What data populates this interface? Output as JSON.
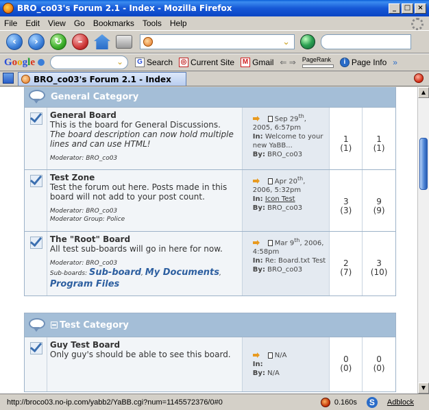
{
  "window": {
    "title": "BRO_co03's Forum 2.1 - Index - Mozilla Firefox",
    "controls": [
      "_",
      "□",
      "×"
    ]
  },
  "menu": [
    "File",
    "Edit",
    "View",
    "Go",
    "Bookmarks",
    "Tools",
    "Help"
  ],
  "nav": {
    "url_value": ""
  },
  "google_toolbar": {
    "search_label": "Search",
    "current_site": "Current Site",
    "gmail": "Gmail",
    "pagerank": "PageRank",
    "page_info": "Page Info"
  },
  "tab": {
    "title": "BRO_co03's Forum 2.1 - Index"
  },
  "categories": [
    {
      "name": "General Category",
      "boards": [
        {
          "name": "General Board",
          "desc": "This is the board for General Discussions.",
          "desc_italic": "The board description can now hold multiple lines and can use HTML!",
          "moderator": "Moderator: BRO_co03",
          "last_date_pre": "Sep 29",
          "last_date_sup": "th",
          "last_date_post": ", 2005, 6:57pm",
          "in_label": "In:",
          "in_value": "Welcome to your new YaBB...",
          "by_label": "By:",
          "by_value": "BRO_co03",
          "topics": "1",
          "topics_sub": "(1)",
          "posts": "1",
          "posts_sub": "(1)"
        },
        {
          "name": "Test Zone",
          "desc": "Test the forum out here. Posts made in this board will not add to your post count.",
          "moderator": "Moderator: BRO_co03",
          "mod_group": "Moderator Group: Police",
          "last_date_pre": "Apr 20",
          "last_date_sup": "th",
          "last_date_post": ", 2006, 5:32pm",
          "in_label": "In:",
          "in_value": "Icon Test",
          "by_label": "By:",
          "by_value": "BRO_co03",
          "topics": "3",
          "topics_sub": "(3)",
          "posts": "9",
          "posts_sub": "(9)"
        },
        {
          "name": "The \"Root\" Board",
          "desc": "All test sub-boards will go in here for now.",
          "moderator": "Moderator: BRO_co03",
          "subboards_label": "Sub-boards:",
          "subboards": [
            "Sub-board",
            "My Documents",
            "Program Files"
          ],
          "last_date_pre": "Mar 9",
          "last_date_sup": "th",
          "last_date_post": ", 2006, 4:58pm",
          "in_label": "In:",
          "in_value": "Re: Board.txt Test",
          "by_label": "By:",
          "by_value": "BRO_co03",
          "topics": "2",
          "topics_sub": "(7)",
          "posts": "3",
          "posts_sub": "(10)"
        }
      ]
    },
    {
      "name": "Test Category",
      "boards": [
        {
          "name": "Guy Test Board",
          "desc": "Only guy's should be able to see this board.",
          "last_date": "N/A",
          "in_label": "In:",
          "by_label": "By:",
          "by_value": "N/A",
          "topics": "0",
          "topics_sub": "(0)",
          "posts": "0",
          "posts_sub": "(0)"
        }
      ]
    }
  ],
  "status": {
    "url": "http://broco03.no-ip.com/yabb2/YaBB.cgi?num=1145572376/0#0",
    "timer": "0.160s",
    "s_icon": "S",
    "adblock": "Adblock"
  }
}
